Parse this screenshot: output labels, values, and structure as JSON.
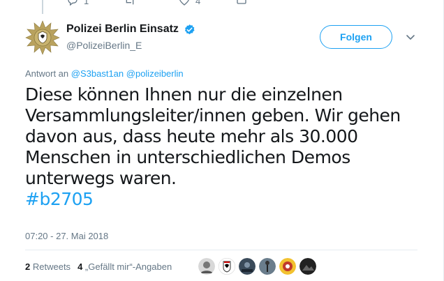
{
  "previous_tweet": {
    "reply_count": "1",
    "like_count": "4"
  },
  "author": {
    "display_name": "Polizei Berlin Einsatz",
    "handle": "@PolizeiBerlin_E",
    "avatar_icon": "police-star-badge-icon",
    "verified_color": "#1da1f2"
  },
  "follow_button": {
    "label": "Folgen"
  },
  "reply_context": {
    "prefix": "Antwort an",
    "mention_1": "@S3bast1an",
    "mention_2": "@polizeiberlin"
  },
  "tweet": {
    "text_line_1": "Diese können Ihnen nur die einzelnen",
    "text_line_2": "Versammlungsleiter/innen geben. Wir gehen",
    "text_line_3": "davon aus, dass heute mehr als 30.000",
    "text_line_4": "Menschen in unterschiedlichen Demos",
    "text_line_5": "unterwegs waren.",
    "hashtag": "#b2705",
    "timestamp": "07:20 - 27. Mai 2018"
  },
  "stats": {
    "retweets_count": "2",
    "retweets_label": "Retweets",
    "likes_count": "4",
    "likes_label": "„Gefällt mir“-Angaben"
  },
  "liker_avatars": [
    "user-avatar-1",
    "user-avatar-2",
    "user-avatar-3",
    "user-avatar-4",
    "user-avatar-5",
    "user-avatar-6"
  ],
  "colors": {
    "accent": "#1da1f2",
    "secondary_text": "#657786",
    "primary_text": "#14171a",
    "badge_gold": "#b9a25e"
  }
}
